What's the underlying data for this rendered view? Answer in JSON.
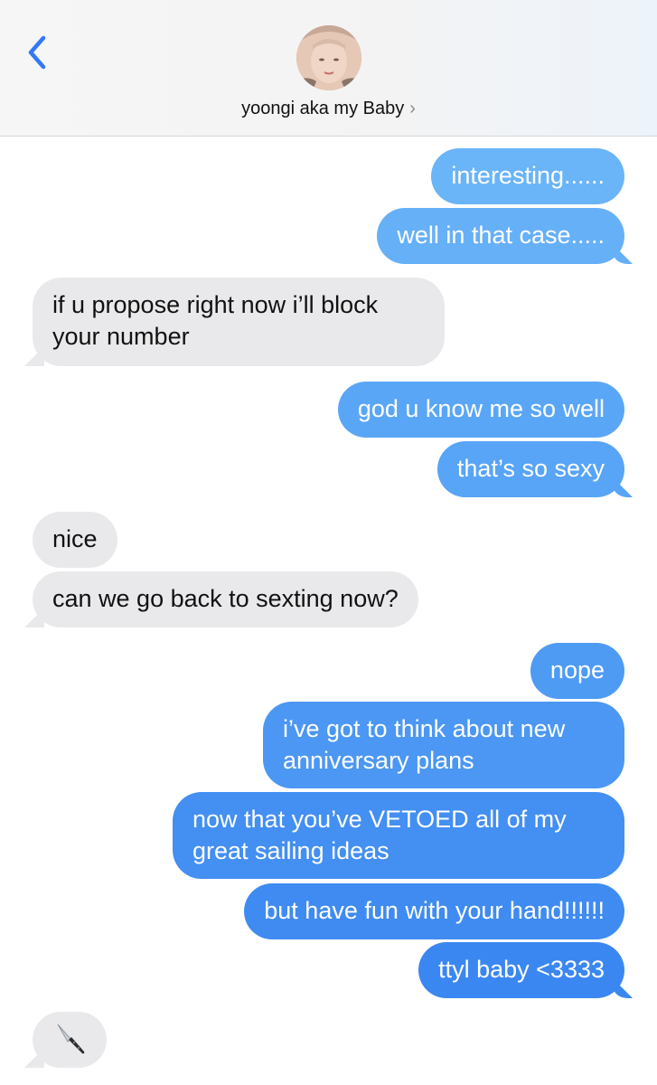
{
  "header": {
    "contact_name": "yoongi aka my Baby",
    "chevron": "›",
    "back_icon": "chevron-left-icon",
    "accent_color": "#3478f6"
  },
  "messages": [
    {
      "direction": "sent",
      "text": "interesting......"
    },
    {
      "direction": "sent",
      "text": "well in that case....."
    },
    {
      "direction": "received",
      "text": "if u propose right now i’ll block your number"
    },
    {
      "direction": "sent",
      "text": "god u know me so well"
    },
    {
      "direction": "sent",
      "text": "that’s so sexy"
    },
    {
      "direction": "received",
      "text": "nice"
    },
    {
      "direction": "received",
      "text": "can we go back to sexting now?"
    },
    {
      "direction": "sent",
      "text": "nope"
    },
    {
      "direction": "sent",
      "text": "i’ve got to think about new anniversary plans"
    },
    {
      "direction": "sent",
      "text": "now that you’ve VETOED all of my great sailing ideas"
    },
    {
      "direction": "sent",
      "text": "but have fun with your hand!!!!!!"
    },
    {
      "direction": "sent",
      "text": "ttyl baby <3333"
    },
    {
      "direction": "received",
      "emoji": "knife-icon"
    }
  ],
  "colors": {
    "sent_top": "#6cb4f8",
    "sent_bottom": "#3a86f1",
    "received_bg": "#e9e9eb"
  }
}
